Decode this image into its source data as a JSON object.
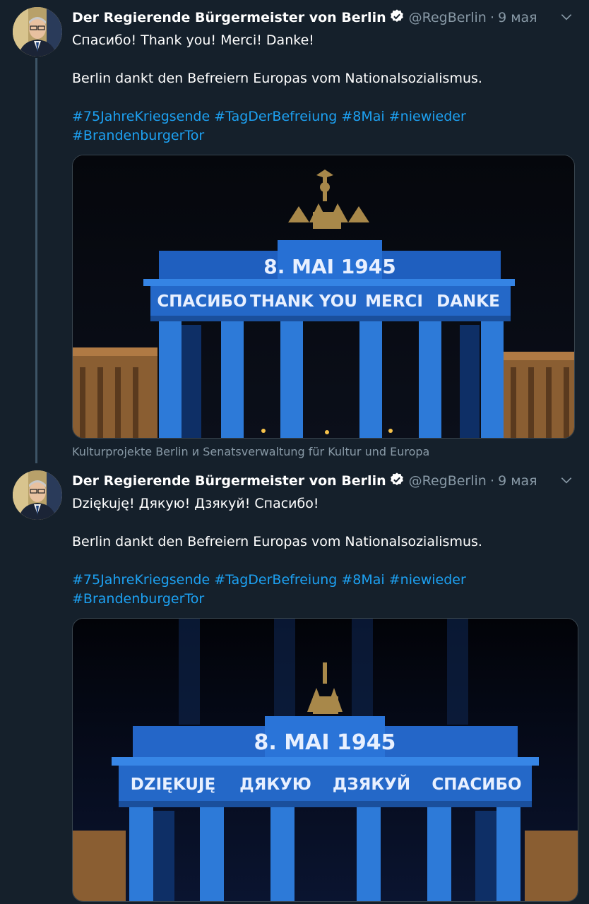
{
  "tweets": [
    {
      "author_name": "Der Regierende Bürgermeister von Berlin",
      "handle": "@RegBerlin",
      "separator": "·",
      "date": "9 мая",
      "text_line1": "Спасибо! Thank you! Merci! Danke!",
      "text_line2": "Berlin dankt den Befreiern Europas vom Nationalsozialismus.",
      "hashtags": [
        "#75JahreKriegsende",
        "#TagDerBefreiung",
        "#8Mai",
        "#niewieder",
        "#BrandenburgerTor"
      ],
      "image": {
        "date_text": "8. MAI 1945",
        "words": [
          "СПАСИБО",
          "THANK YOU",
          "MERCI",
          "DANKE"
        ]
      },
      "image_caption": "Kulturprojekte Berlin и Senatsverwaltung für Kultur und Europa"
    },
    {
      "author_name": "Der Regierende Bürgermeister von Berlin",
      "handle": "@RegBerlin",
      "separator": "·",
      "date": "9 мая",
      "text_line1": "Dziękuję! Дякую! Дзякуй! Спасибо!",
      "text_line2": "Berlin dankt den Befreiern Europas vom Nationalsozialismus.",
      "hashtags": [
        "#75JahreKriegsende",
        "#TagDerBefreiung",
        "#8Mai",
        "#niewieder",
        "#BrandenburgerTor"
      ],
      "image": {
        "date_text": "8. MAI 1945",
        "words": [
          "DZIĘKUJĘ",
          "ДЯКУЮ",
          "ДЗЯКУЙ",
          "СПАСИБО"
        ]
      }
    }
  ],
  "colors": {
    "background": "#15202b",
    "link": "#1da1f2",
    "secondary": "#8899a6",
    "projection": "#2e7de0"
  },
  "icons": [
    "verified-badge-icon",
    "chevron-down-icon"
  ]
}
